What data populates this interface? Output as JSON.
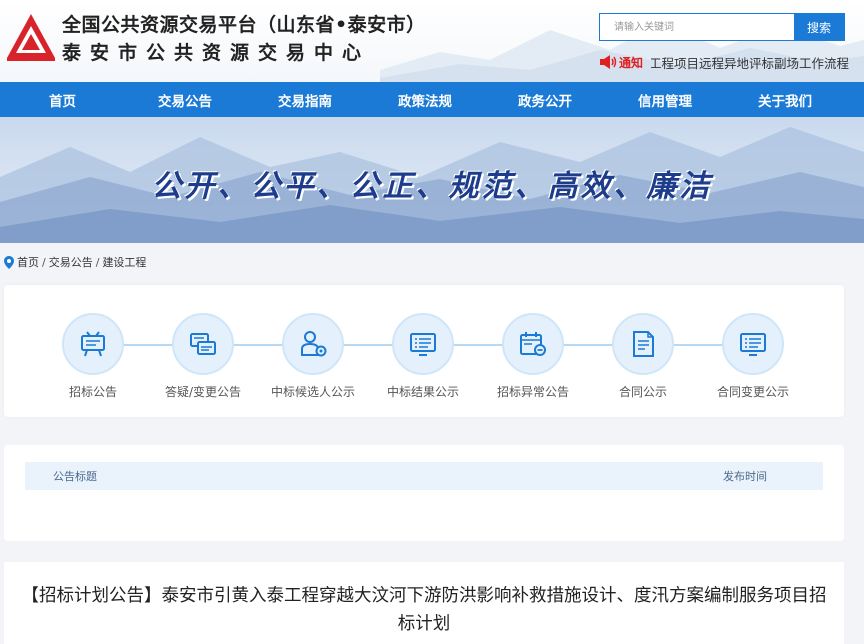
{
  "header": {
    "title_line1": "全国公共资源交易平台（山东省•泰安市）",
    "title_line2": "泰安市公共资源交易中心",
    "search_placeholder": "请输入关键词",
    "search_button": "搜索",
    "notice_tag": "通知",
    "notice_text": "工程项目远程异地评标副场工作流程"
  },
  "nav": {
    "items": [
      "首页",
      "交易公告",
      "交易指南",
      "政策法规",
      "政务公开",
      "信用管理",
      "关于我们"
    ]
  },
  "banner": {
    "slogan": "公开、公平、公正、规范、高效、廉洁"
  },
  "breadcrumb": {
    "items": [
      "首页",
      "交易公告",
      "建设工程"
    ],
    "separator": "/"
  },
  "process": {
    "steps": [
      {
        "label": "招标公告",
        "icon": "easel-icon"
      },
      {
        "label": "答疑/变更公告",
        "icon": "cards-icon"
      },
      {
        "label": "中标候选人公示",
        "icon": "person-icon"
      },
      {
        "label": "中标结果公示",
        "icon": "monitor-list-icon"
      },
      {
        "label": "招标异常公告",
        "icon": "calendar-minus-icon"
      },
      {
        "label": "合同公示",
        "icon": "contract-icon"
      },
      {
        "label": "合同变更公示",
        "icon": "monitor-list-icon"
      }
    ]
  },
  "table": {
    "col_title": "公告标题",
    "col_date": "发布时间"
  },
  "article": {
    "title": "【招标计划公告】泰安市引黄入泰工程穿越大汶河下游防洪影响补救措施设计、度汛方案编制服务项目招标计划"
  },
  "colors": {
    "primary": "#1a7ad6",
    "slogan": "#1d3c8c",
    "notice": "#e02020",
    "logo": "#d8232a"
  }
}
